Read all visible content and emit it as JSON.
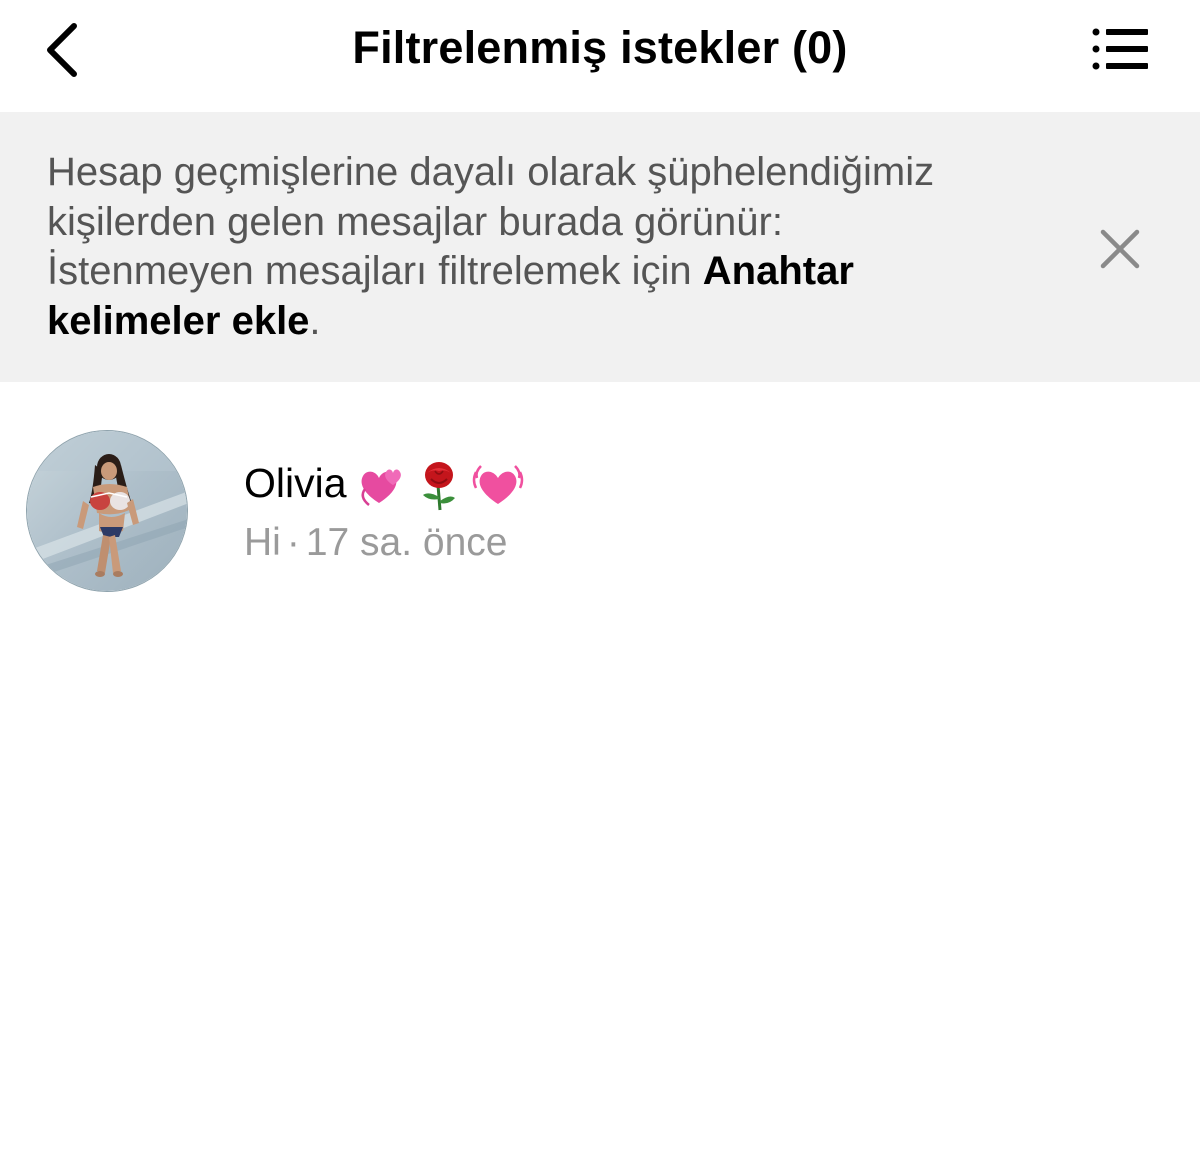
{
  "header": {
    "title": "Filtrelenmiş istekler (0)",
    "back_icon": "chevron-left-icon",
    "menu_icon": "list-icon"
  },
  "banner": {
    "line1": "Hesap geçmişlerine dayalı olarak şüphelendiğimiz",
    "line2": "kişilerden gelen mesajlar burada görünür:",
    "line3_prefix": "İstenmeyen mesajları filtrelemek için ",
    "link_part1": "Anahtar",
    "link_part2": "kelimeler ekle",
    "suffix": ".",
    "close_icon": "close-icon"
  },
  "requests": [
    {
      "name": "Olivia",
      "emojis": [
        "revolving-hearts-icon",
        "rose-icon",
        "beating-heart-icon"
      ],
      "message": "Hi",
      "separator": "·",
      "time": "17 sa. önce"
    }
  ],
  "colors": {
    "banner_bg": "#f1f1f1",
    "banner_text": "#555555",
    "preview_text": "#9a9a9a",
    "title_text": "#000000"
  }
}
